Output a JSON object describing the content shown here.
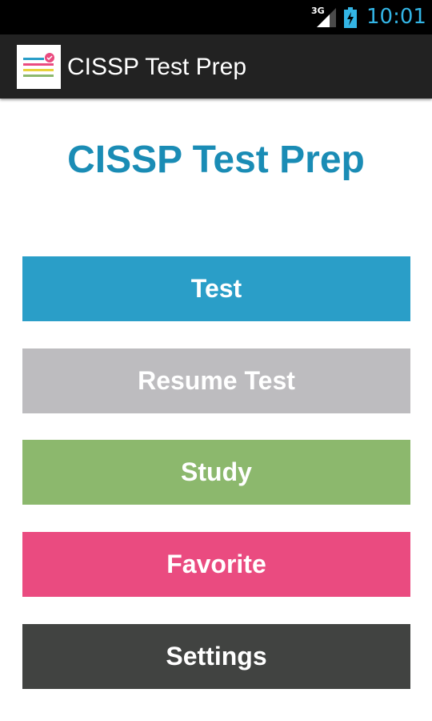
{
  "status_bar": {
    "network": "3G",
    "time": "10:01",
    "clock_color": "#33b5e5"
  },
  "action_bar": {
    "title": "CISSP Test Prep",
    "logo_icon": "notes-icon"
  },
  "main": {
    "heading": "CISSP Test Prep",
    "heading_color": "#1a8cb5"
  },
  "buttons": [
    {
      "label": "Test",
      "color": "#2a9ec8"
    },
    {
      "label": "Resume Test",
      "color": "#bdbcbf"
    },
    {
      "label": "Study",
      "color": "#8cb86d"
    },
    {
      "label": "Favorite",
      "color": "#ea4b80"
    },
    {
      "label": "Settings",
      "color": "#414341"
    }
  ]
}
